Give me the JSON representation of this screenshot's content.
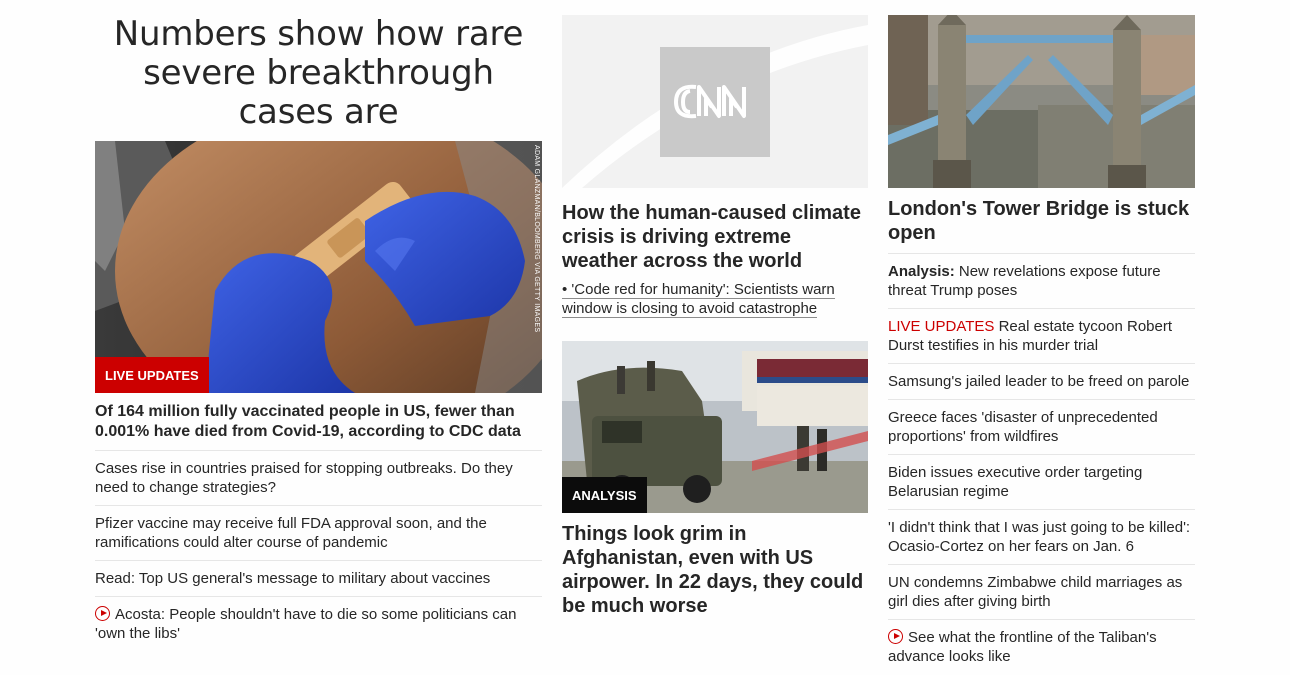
{
  "col1": {
    "headline": "Numbers show how rare severe breakthrough cases are",
    "badge": "LIVE UPDATES",
    "photo_credit": "ADAM GLANZMAN/BLOOMBERG VIA GETTY IMAGES",
    "story_title": "Of 164 million fully vaccinated people in US, fewer than 0.001% have died from Covid-19, according to CDC data",
    "links": [
      "Cases rise in countries praised for stopping outbreaks. Do they need to change strategies?",
      "Pfizer vaccine may receive full FDA approval soon, and the ramifications could alter course of pandemic",
      "Read: Top US general's message to military about vaccines",
      "Acosta: People shouldn't have to die so some politicians can 'own the libs'"
    ]
  },
  "col2": {
    "story1_title": "How the human-caused climate crisis is driving extreme weather across the world",
    "story1_sub": "• 'Code red for humanity': Scientists warn window is closing to avoid catastrophe",
    "badge": "ANALYSIS",
    "story2_title": "Things look grim in Afghanistan, even with US airpower. In 22 days, they could be much worse"
  },
  "col3": {
    "story_title": "London's Tower Bridge is stuck open",
    "links": [
      {
        "prefix": "Analysis:",
        "text": " New revelations expose future threat Trump poses"
      },
      {
        "prefix": "LIVE UPDATES",
        "text": " Real estate tycoon Robert Durst testifies in his murder trial"
      },
      {
        "prefix": "",
        "text": "Samsung's jailed leader to be freed on parole"
      },
      {
        "prefix": "",
        "text": "Greece faces 'disaster of unprecedented proportions' from wildfires"
      },
      {
        "prefix": "",
        "text": "Biden issues executive order targeting Belarusian regime"
      },
      {
        "prefix": "",
        "text": "'I didn't think that I was just going to be killed': Ocasio-Cortez on her fears on Jan. 6"
      },
      {
        "prefix": "",
        "text": "UN condemns Zimbabwe child marriages as girl dies after giving birth"
      },
      {
        "prefix": "",
        "text": "See what the frontline of the Taliban's advance looks like"
      }
    ]
  },
  "colors": {
    "accent_red": "#cc0000",
    "text": "#262626",
    "divider": "#e6e6e6"
  }
}
